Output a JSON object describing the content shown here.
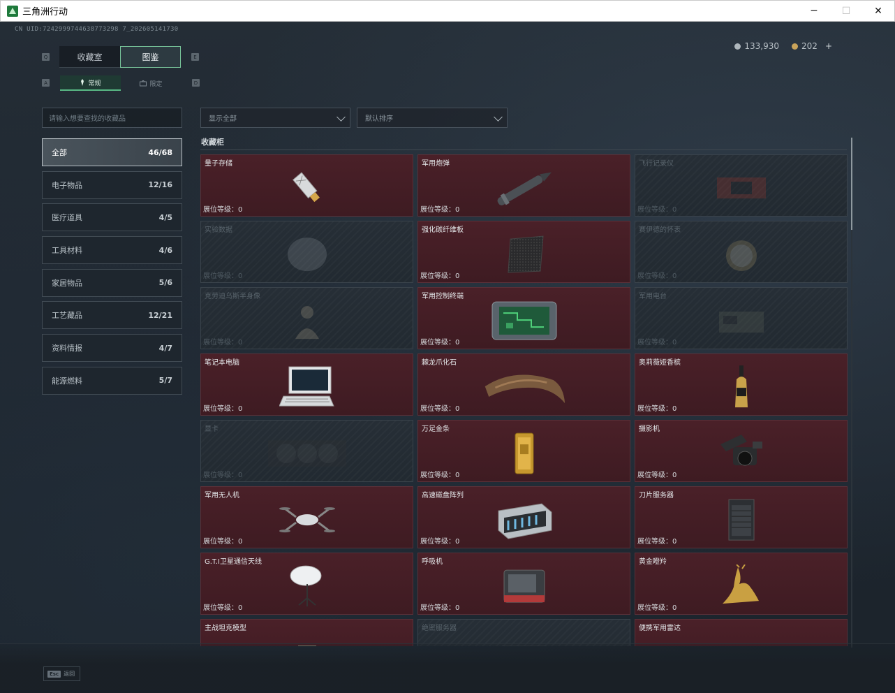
{
  "window": {
    "title": "三角洲行动",
    "minimize": "─",
    "maximize": "☐",
    "close": "✕"
  },
  "header": {
    "uid": "CN UID:7242999744638773298 7_202605141730",
    "silver": "133,930",
    "gold": "202",
    "plus": "+"
  },
  "tabs": {
    "left_key": "Q",
    "right_key": "E",
    "items": [
      "收藏室",
      "图鉴"
    ],
    "active": "图鉴"
  },
  "subtabs": {
    "left_key": "A",
    "right_key": "D",
    "items": [
      "常规",
      "限定"
    ],
    "active": "常规"
  },
  "search": {
    "placeholder": "请输入想要查找的收藏品"
  },
  "filters": {
    "display": "显示全部",
    "sort": "默认排序"
  },
  "categories": [
    {
      "label": "全部",
      "count": "46/68",
      "active": true
    },
    {
      "label": "电子物品",
      "count": "12/16"
    },
    {
      "label": "医疗道具",
      "count": "4/5"
    },
    {
      "label": "工具材料",
      "count": "4/6"
    },
    {
      "label": "家居物品",
      "count": "5/6"
    },
    {
      "label": "工艺藏品",
      "count": "12/21"
    },
    {
      "label": "资料情报",
      "count": "4/7"
    },
    {
      "label": "能源燃料",
      "count": "5/7"
    }
  ],
  "cabinet": {
    "title": "收藏柜",
    "level_label": "展位等级：0",
    "items": [
      {
        "name": "量子存储",
        "unlocked": true,
        "icon": "usb-drive-icon"
      },
      {
        "name": "军用炮弹",
        "unlocked": true,
        "icon": "artillery-shell-icon"
      },
      {
        "name": "飞行记录仪",
        "unlocked": false,
        "icon": "flight-recorder-icon"
      },
      {
        "name": "实验数据",
        "unlocked": false,
        "icon": "data-disc-icon"
      },
      {
        "name": "强化碳纤维板",
        "unlocked": true,
        "icon": "carbon-plate-icon"
      },
      {
        "name": "赛伊德的怀表",
        "unlocked": false,
        "icon": "pocket-watch-icon"
      },
      {
        "name": "克劳迪乌斯半身像",
        "unlocked": false,
        "icon": "bust-statue-icon"
      },
      {
        "name": "军用控制终端",
        "unlocked": true,
        "icon": "control-terminal-icon"
      },
      {
        "name": "军用电台",
        "unlocked": false,
        "icon": "military-radio-icon"
      },
      {
        "name": "笔记本电脑",
        "unlocked": true,
        "icon": "laptop-icon"
      },
      {
        "name": "棘龙爪化石",
        "unlocked": true,
        "icon": "claw-fossil-icon"
      },
      {
        "name": "奥莉薇娅香槟",
        "unlocked": true,
        "icon": "champagne-icon"
      },
      {
        "name": "显卡",
        "unlocked": false,
        "icon": "graphics-card-icon"
      },
      {
        "name": "万足金条",
        "unlocked": true,
        "icon": "gold-bar-icon"
      },
      {
        "name": "摄影机",
        "unlocked": true,
        "icon": "camera-icon"
      },
      {
        "name": "军用无人机",
        "unlocked": true,
        "icon": "drone-icon"
      },
      {
        "name": "高速磁盘阵列",
        "unlocked": true,
        "icon": "disk-array-icon"
      },
      {
        "name": "刀片服务器",
        "unlocked": true,
        "icon": "blade-server-icon"
      },
      {
        "name": "G.T.I卫星通信天线",
        "unlocked": true,
        "icon": "satellite-dish-icon"
      },
      {
        "name": "呼吸机",
        "unlocked": true,
        "icon": "ventilator-icon"
      },
      {
        "name": "黄金瞪羚",
        "unlocked": true,
        "icon": "gold-gazelle-icon"
      },
      {
        "name": "主战坦克模型",
        "unlocked": true,
        "icon": "tank-model-icon"
      },
      {
        "name": "绝密服务器",
        "unlocked": false,
        "icon": "secret-server-icon"
      },
      {
        "name": "便携军用雷达",
        "unlocked": true,
        "icon": "portable-radar-icon"
      }
    ]
  },
  "footer": {
    "esc_key": "Esc",
    "esc_label": "返回"
  }
}
